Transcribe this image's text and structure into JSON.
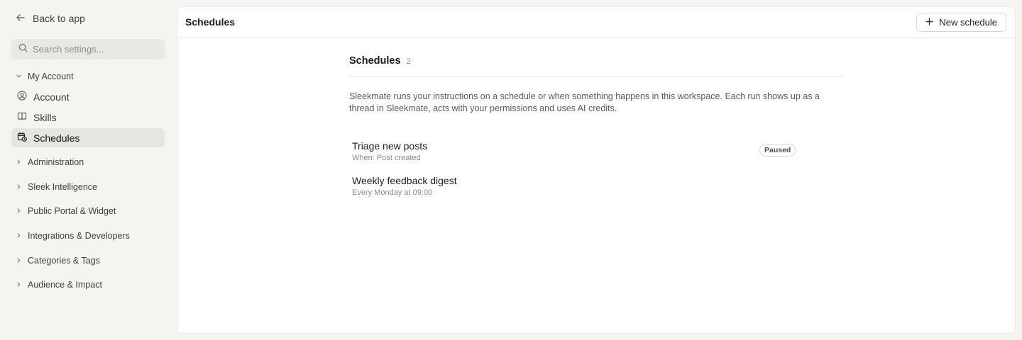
{
  "sidebar": {
    "back_label": "Back to app",
    "search_placeholder": "Search settings...",
    "my_account_label": "My Account",
    "items": [
      {
        "label": "Account",
        "icon": "user-circle-icon"
      },
      {
        "label": "Skills",
        "icon": "book-icon"
      },
      {
        "label": "Schedules",
        "icon": "calendar-clock-icon",
        "active": true
      }
    ],
    "sections": [
      {
        "label": "Administration"
      },
      {
        "label": "Sleek Intelligence"
      },
      {
        "label": "Public Portal & Widget"
      },
      {
        "label": "Integrations & Developers"
      },
      {
        "label": "Categories & Tags"
      },
      {
        "label": "Audience & Impact"
      }
    ]
  },
  "topbar": {
    "title": "Schedules",
    "new_button_label": "New schedule"
  },
  "content": {
    "title": "Schedules",
    "count": "2",
    "description": "Sleekmate runs your instructions on a schedule or when something happens in this workspace. Each run shows up as a thread in Sleekmate, acts with your permissions and uses AI credits.",
    "schedules": [
      {
        "name": "Triage new posts",
        "trigger": "When: Post created",
        "status": "Paused"
      },
      {
        "name": "Weekly feedback digest",
        "trigger": "Every Monday at 09:00",
        "status": ""
      }
    ]
  },
  "colors": {
    "sidebar_bg": "#f5f4f1",
    "active_item_bg": "#e6e5e1",
    "panel_bg": "#ffffff"
  }
}
